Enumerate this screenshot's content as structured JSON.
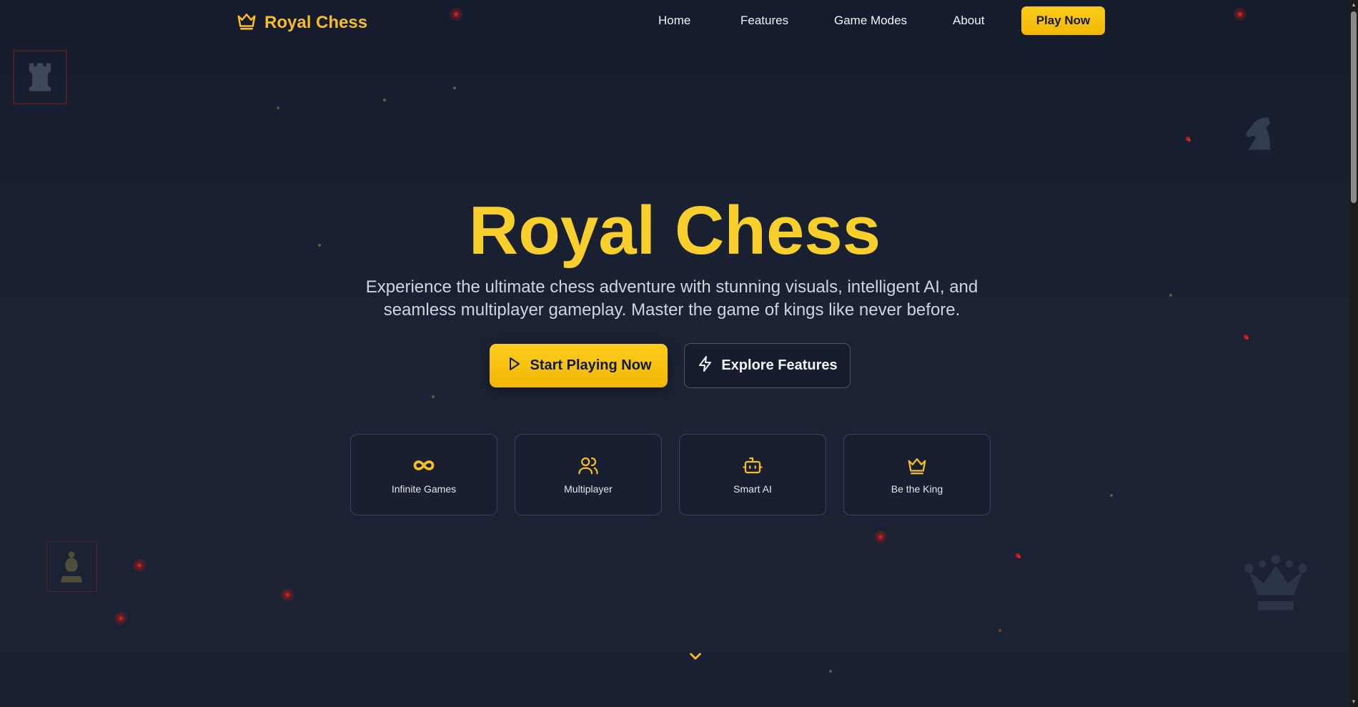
{
  "brand": {
    "name": "Royal Chess",
    "icon": "crown-icon"
  },
  "nav": {
    "links": [
      "Home",
      "Features",
      "Game Modes",
      "About"
    ],
    "cta": "Play Now"
  },
  "hero": {
    "title": "Royal Chess",
    "subtitle_line1": "Experience the ultimate chess adventure with stunning visuals, intelligent AI, and",
    "subtitle_line2": "seamless multiplayer gameplay. Master the game of kings like never before.",
    "primary_button": {
      "label": "Start Playing Now",
      "icon": "play-icon"
    },
    "secondary_button": {
      "label": "Explore Features",
      "icon": "lightning-icon"
    }
  },
  "features": [
    {
      "label": "Infinite Games",
      "icon": "infinity-icon"
    },
    {
      "label": "Multiplayer",
      "icon": "users-icon"
    },
    {
      "label": "Smart AI",
      "icon": "robot-icon"
    },
    {
      "label": "Be the King",
      "icon": "crown-icon"
    }
  ],
  "scroll_indicator": {
    "icon": "chevron-down-icon"
  },
  "colors": {
    "accent": "#f6be25",
    "background": "#161d2f",
    "text": "#e5e7eb"
  }
}
